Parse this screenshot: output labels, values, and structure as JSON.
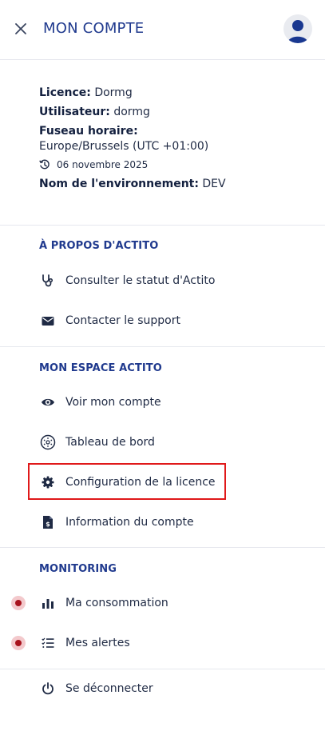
{
  "header": {
    "title": "MON COMPTE",
    "close_icon": "close-icon",
    "avatar_icon": "user-avatar-icon"
  },
  "info": {
    "licence_label": "Licence:",
    "licence_value": "Dormg",
    "user_label": "Utilisateur:",
    "user_value": "dormg",
    "tz_label": "Fuseau horaire:",
    "tz_value": "Europe/Brussels (UTC +01:00)",
    "date_value": "06 novembre 2025",
    "env_label": "Nom de l'environnement:",
    "env_value": "DEV"
  },
  "sections": {
    "about": {
      "title": "À PROPOS D'ACTITO",
      "items": [
        {
          "label": "Consulter le statut d'Actito",
          "icon": "stethoscope-icon"
        },
        {
          "label": "Contacter le support",
          "icon": "envelope-icon"
        }
      ]
    },
    "space": {
      "title": "MON ESPACE ACTITO",
      "items": [
        {
          "label": "Voir mon compte",
          "icon": "eye-icon"
        },
        {
          "label": "Tableau de bord",
          "icon": "dashboard-icon"
        },
        {
          "label": "Configuration de la licence",
          "icon": "gear-icon"
        },
        {
          "label": "Information du compte",
          "icon": "file-invoice-icon"
        }
      ]
    },
    "monitoring": {
      "title": "MONITORING",
      "items": [
        {
          "label": "Ma consommation",
          "icon": "bar-chart-icon"
        },
        {
          "label": "Mes alertes",
          "icon": "checklist-icon"
        }
      ]
    },
    "logout": {
      "label": "Se déconnecter",
      "icon": "power-icon"
    }
  },
  "colors": {
    "primary": "#203a8e",
    "text": "#1f2a44",
    "alert": "#a8131d",
    "highlight": "#e0191a"
  }
}
